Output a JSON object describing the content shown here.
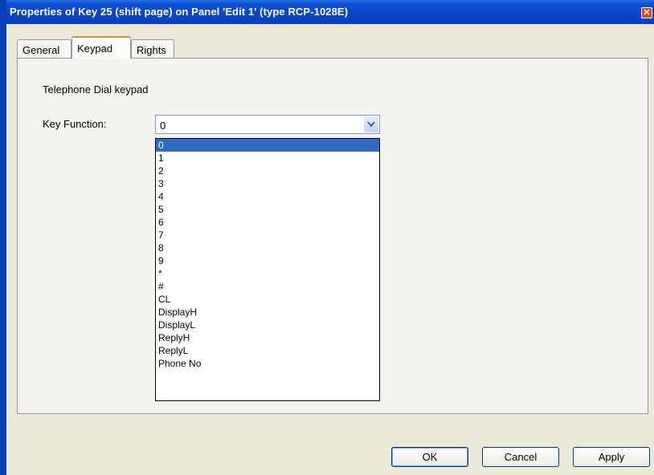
{
  "window": {
    "title": "Properties of Key 25 (shift page) on Panel 'Edit 1' (type RCP-1028E)",
    "close_glyph": "✕"
  },
  "tabs": [
    {
      "label": "General"
    },
    {
      "label": "Keypad",
      "active": true
    },
    {
      "label": "Rights"
    }
  ],
  "keypad": {
    "heading": "Telephone Dial keypad",
    "key_function_label": "Key Function:",
    "key_function_value": "0",
    "options": [
      "0",
      "1",
      "2",
      "3",
      "4",
      "5",
      "6",
      "7",
      "8",
      "9",
      "*",
      "#",
      "CL",
      "DisplayH",
      "DisplayL",
      "ReplyH",
      "ReplyL",
      "Phone No"
    ],
    "highlighted_option": "0"
  },
  "buttons": {
    "ok": "OK",
    "cancel": "Cancel",
    "apply": "Apply"
  },
  "colors": {
    "titlebar": "#0a4fd4",
    "selection": "#316ac5",
    "dialog_bg": "#ece9d8"
  }
}
